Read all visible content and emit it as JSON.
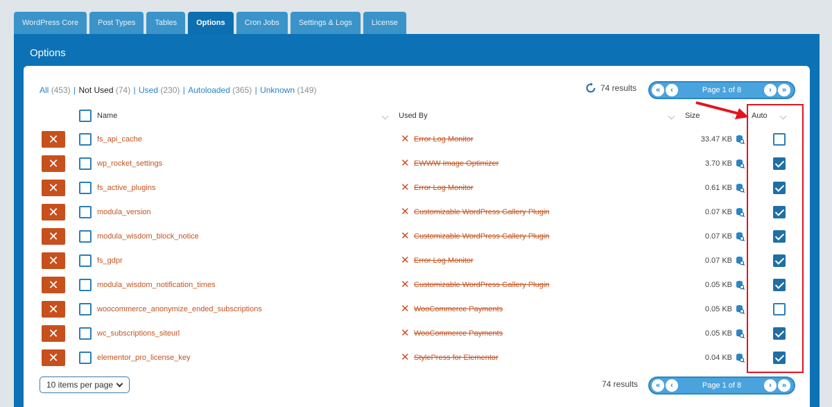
{
  "tabs": [
    "WordPress Core",
    "Post Types",
    "Tables",
    "Options",
    "Cron Jobs",
    "Settings & Logs",
    "License"
  ],
  "active_tab": "Options",
  "panel_title": "Options",
  "filters": [
    {
      "label": "All",
      "count": "(453)"
    },
    {
      "label": "Not Used",
      "count": "(74)"
    },
    {
      "label": "Used",
      "count": "(230)"
    },
    {
      "label": "Autoloaded",
      "count": "(365)"
    },
    {
      "label": "Unknown",
      "count": "(149)"
    }
  ],
  "results_text": "74 results",
  "pager_label": "Page 1 of 8",
  "columns": {
    "name": "Name",
    "used_by": "Used By",
    "size": "Size",
    "auto": "Auto"
  },
  "rows": [
    {
      "name": "fs_api_cache",
      "used_by": "Error Log Monitor",
      "size": "33.47 KB",
      "auto": false
    },
    {
      "name": "wp_rocket_settings",
      "used_by": "EWWW Image Optimizer",
      "size": "3.70 KB",
      "auto": true
    },
    {
      "name": "fs_active_plugins",
      "used_by": "Error Log Monitor",
      "size": "0.61 KB",
      "auto": true
    },
    {
      "name": "modula_version",
      "used_by": "Customizable WordPress Gallery Plugin",
      "size": "0.07 KB",
      "auto": true
    },
    {
      "name": "modula_wisdom_block_notice",
      "used_by": "Customizable WordPress Gallery Plugin",
      "size": "0.07 KB",
      "auto": true
    },
    {
      "name": "fs_gdpr",
      "used_by": "Error Log Monitor",
      "size": "0.07 KB",
      "auto": true
    },
    {
      "name": "modula_wisdom_notification_times",
      "used_by": "Customizable WordPress Gallery Plugin",
      "size": "0.05 KB",
      "auto": true
    },
    {
      "name": "woocommerce_anonymize_ended_subscriptions",
      "used_by": "WooCommerce Payments",
      "size": "0.05 KB",
      "auto": false
    },
    {
      "name": "wc_subscriptions_siteurl",
      "used_by": "WooCommerce Payments",
      "size": "0.05 KB",
      "auto": true
    },
    {
      "name": "elementor_pro_license_key",
      "used_by": "StylePress for Elementor",
      "size": "0.04 KB",
      "auto": true
    }
  ],
  "per_page": "10 items per page",
  "colors": {
    "accent": "#0c72b5",
    "delete": "#c7501c",
    "annotation": "#e3141f"
  },
  "icons": {
    "refresh": "refresh-icon",
    "delete": "close-icon",
    "not_used": "x-icon",
    "inspect": "database-search-icon"
  }
}
